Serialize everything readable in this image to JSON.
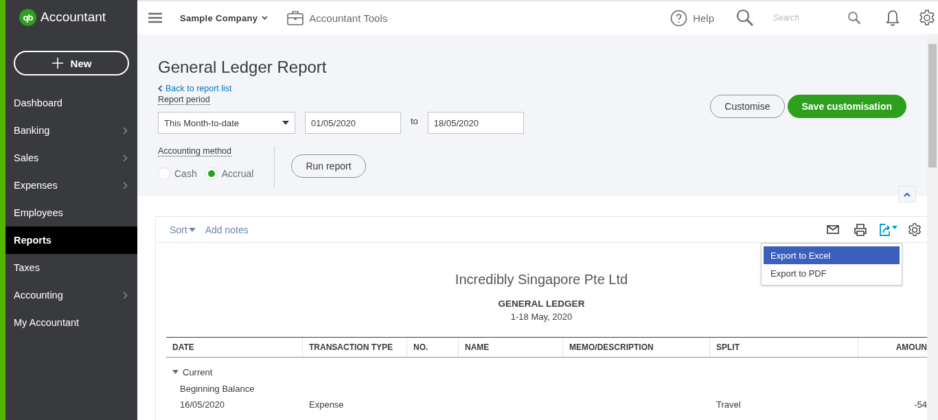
{
  "brand": {
    "logo": "qb",
    "name": "Accountant"
  },
  "new_button": {
    "label": "New"
  },
  "sidebar": {
    "items": [
      {
        "label": "Dashboard",
        "selected": false,
        "has_submenu": false
      },
      {
        "label": "Banking",
        "selected": false,
        "has_submenu": true
      },
      {
        "label": "Sales",
        "selected": false,
        "has_submenu": true
      },
      {
        "label": "Expenses",
        "selected": false,
        "has_submenu": true
      },
      {
        "label": "Employees",
        "selected": false,
        "has_submenu": false
      },
      {
        "label": "Reports",
        "selected": true,
        "has_submenu": false
      },
      {
        "label": "Taxes",
        "selected": false,
        "has_submenu": false
      },
      {
        "label": "Accounting",
        "selected": false,
        "has_submenu": true
      },
      {
        "label": "My Accountant",
        "selected": false,
        "has_submenu": false
      }
    ]
  },
  "topbar": {
    "company": "Sample Company",
    "tools": "Accountant Tools",
    "help": "Help",
    "search": {
      "placeholder": "Search"
    }
  },
  "page": {
    "title": "General Ledger Report",
    "back_link": "Back to report list",
    "report_period": {
      "label": "Report period",
      "preset": "This Month-to-date",
      "from": "01/05/2020",
      "to_label": "to",
      "to": "18/05/2020"
    },
    "accounting_method": {
      "label": "Accounting method",
      "options": [
        {
          "label": "Cash",
          "selected": false
        },
        {
          "label": "Accrual",
          "selected": true
        }
      ]
    },
    "run_button": "Run report",
    "customise_button": "Customise",
    "save_button": "Save customisation"
  },
  "report": {
    "toolbar": {
      "sort": "Sort",
      "notes": "Add notes"
    },
    "export_menu": {
      "items": [
        {
          "label": "Export to Excel",
          "highlighted": true
        },
        {
          "label": "Export to PDF",
          "highlighted": false
        }
      ]
    },
    "company": "Incredibly Singapore Pte Ltd",
    "title": "GENERAL LEDGER",
    "period": "1-18 May, 2020",
    "table": {
      "columns": [
        "DATE",
        "TRANSACTION TYPE",
        "NO.",
        "NAME",
        "MEMO/DESCRIPTION",
        "SPLIT",
        "AMOUN"
      ],
      "group": {
        "label": "Current",
        "expanded": true
      },
      "rows": [
        {
          "kind": "label",
          "cells": [
            "Beginning Balance"
          ]
        },
        {
          "kind": "data",
          "cells": [
            "16/05/2020",
            "Expense",
            "",
            "",
            "",
            "Travel",
            "-54"
          ]
        }
      ]
    }
  }
}
